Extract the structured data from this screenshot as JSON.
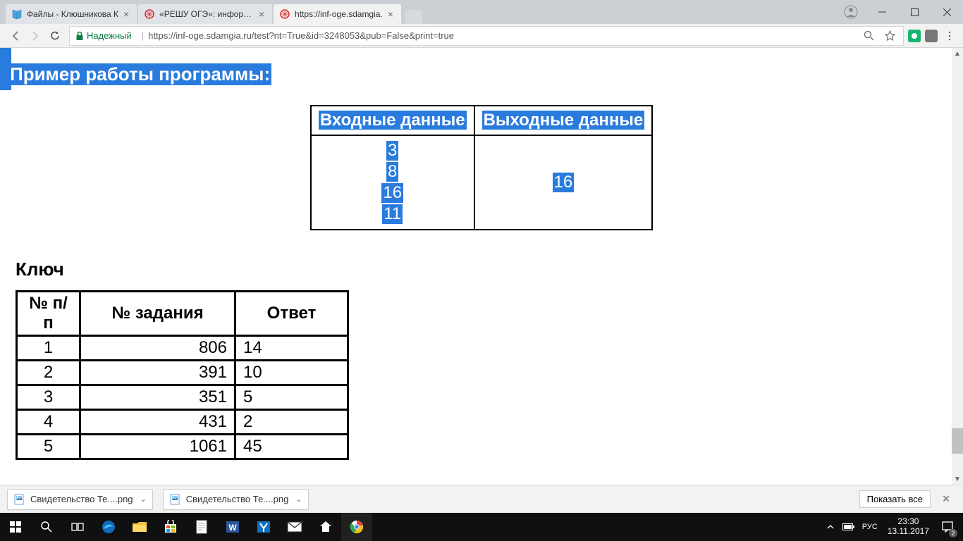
{
  "tabs": [
    {
      "title": "Файлы - Клюшникова К",
      "favicon": "blue"
    },
    {
      "title": "«РЕШУ ОГЭ»: информат",
      "favicon": "red"
    },
    {
      "title": "https://inf-oge.sdamgia.",
      "favicon": "red",
      "active": true
    }
  ],
  "url": {
    "secure_label": "Надежный",
    "text": "https://inf-oge.sdamgia.ru/test?nt=True&id=3248053&pub=False&print=true"
  },
  "page": {
    "heading_selected": "Пример работы программы:",
    "example_table": {
      "headers": [
        "Входные данные",
        "Выходные данные"
      ],
      "input_lines": [
        "3",
        "8",
        "16",
        "11"
      ],
      "output": "16"
    },
    "key_heading": "Ключ",
    "answer_table": {
      "headers": [
        "№ п/п",
        "№ задания",
        "Ответ"
      ],
      "rows": [
        {
          "n": "1",
          "task": "806",
          "ans": "14"
        },
        {
          "n": "2",
          "task": "391",
          "ans": "10"
        },
        {
          "n": "3",
          "task": "351",
          "ans": "5"
        },
        {
          "n": "4",
          "task": "431",
          "ans": "2"
        },
        {
          "n": "5",
          "task": "1061",
          "ans": "45"
        }
      ]
    }
  },
  "downloads": {
    "items": [
      "Свидетельство Те....png",
      "Свидетельство Те....png"
    ],
    "show_all": "Показать все"
  },
  "taskbar": {
    "lang": "РУС",
    "time": "23:30",
    "date": "13.11.2017",
    "notif_count": "2"
  }
}
